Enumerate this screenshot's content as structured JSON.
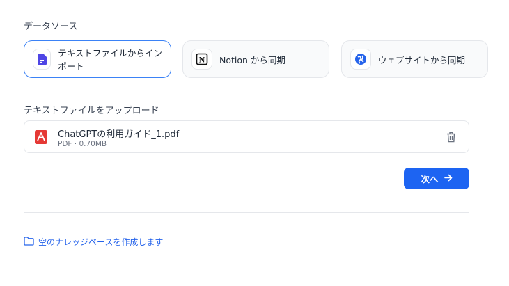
{
  "data_source": {
    "label": "データソース",
    "options": [
      {
        "label": "テキストファイルからインポート",
        "icon": "document-icon",
        "selected": true
      },
      {
        "label": "Notion から同期",
        "icon": "notion-icon",
        "selected": false
      },
      {
        "label": "ウェブサイトから同期",
        "icon": "website-icon",
        "selected": false
      }
    ]
  },
  "upload": {
    "label": "テキストファイルをアップロード",
    "file": {
      "name": "ChatGPTの利用ガイド_1.pdf",
      "meta": "PDF · 0.70MB",
      "icon": "pdf-icon"
    }
  },
  "actions": {
    "next_label": "次へ",
    "next_icon": "arrow-right-icon"
  },
  "footer": {
    "create_empty_label": "空のナレッジベースを作成します",
    "icon": "folder-icon"
  },
  "colors": {
    "accent": "#1d64f2",
    "selected_border": "#3b82f6",
    "link": "#2563eb",
    "pdf_red": "#e53935"
  }
}
